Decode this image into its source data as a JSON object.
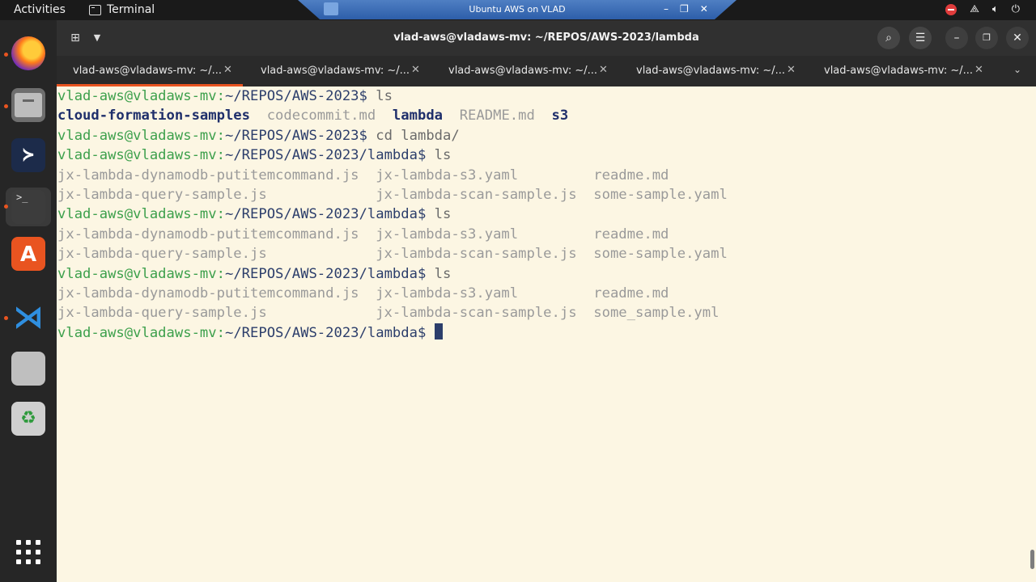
{
  "topbar": {
    "activities": "Activities",
    "app_name": "Terminal",
    "vm_title": "Ubuntu AWS on VLAD",
    "vm_controls": [
      "–",
      "❐",
      "✕"
    ]
  },
  "window": {
    "title": "vlad-aws@vladaws-mv: ~/REPOS/AWS-2023/lambda"
  },
  "tabs": [
    {
      "label": "vlad-aws@vladaws-mv: ~/...",
      "active": true
    },
    {
      "label": "vlad-aws@vladaws-mv: ~/...",
      "active": false
    },
    {
      "label": "vlad-aws@vladaws-mv: ~/...",
      "active": false
    },
    {
      "label": "vlad-aws@vladaws-mv: ~/...",
      "active": false
    },
    {
      "label": "vlad-aws@vladaws-mv: ~/...",
      "active": false
    }
  ],
  "terminal": {
    "prompt_user": "vlad-aws@vladaws-mv",
    "lines": [
      {
        "type": "prompt",
        "path": "~/REPOS/AWS-2023",
        "cmd": "ls"
      },
      {
        "type": "out",
        "cells": [
          {
            "t": "cloud-formation-samples",
            "k": "dir"
          },
          {
            "t": "  codecommit.md  ",
            "k": "file"
          },
          {
            "t": "lambda",
            "k": "dir"
          },
          {
            "t": "  README.md  ",
            "k": "file"
          },
          {
            "t": "s3",
            "k": "dir"
          }
        ]
      },
      {
        "type": "prompt",
        "path": "~/REPOS/AWS-2023",
        "cmd": "cd lambda/"
      },
      {
        "type": "prompt",
        "path": "~/REPOS/AWS-2023/lambda",
        "cmd": "ls"
      },
      {
        "type": "out",
        "cells": [
          {
            "t": "jx-lambda-dynamodb-putitemcommand.js  jx-lambda-s3.yaml         readme.md",
            "k": "file"
          }
        ]
      },
      {
        "type": "out",
        "cells": [
          {
            "t": "jx-lambda-query-sample.js             jx-lambda-scan-sample.js  some-sample.yaml",
            "k": "file"
          }
        ]
      },
      {
        "type": "prompt",
        "path": "~/REPOS/AWS-2023/lambda",
        "cmd": "ls"
      },
      {
        "type": "out",
        "cells": [
          {
            "t": "jx-lambda-dynamodb-putitemcommand.js  jx-lambda-s3.yaml         readme.md",
            "k": "file"
          }
        ]
      },
      {
        "type": "out",
        "cells": [
          {
            "t": "jx-lambda-query-sample.js             jx-lambda-scan-sample.js  some-sample.yaml",
            "k": "file"
          }
        ]
      },
      {
        "type": "prompt",
        "path": "~/REPOS/AWS-2023/lambda",
        "cmd": "ls"
      },
      {
        "type": "out",
        "cells": [
          {
            "t": "jx-lambda-dynamodb-putitemcommand.js  jx-lambda-s3.yaml         readme.md",
            "k": "file"
          }
        ]
      },
      {
        "type": "out",
        "cells": [
          {
            "t": "jx-lambda-query-sample.js             jx-lambda-scan-sample.js  some_sample.yml",
            "k": "file"
          }
        ]
      },
      {
        "type": "prompt",
        "path": "~/REPOS/AWS-2023/lambda",
        "cmd": "",
        "cursor": true
      }
    ]
  },
  "colors": {
    "accent": "#e95420",
    "prompt_user": "#3da04c",
    "prompt_path": "#2c3e6b",
    "terminal_bg": "#fcf6e3"
  }
}
